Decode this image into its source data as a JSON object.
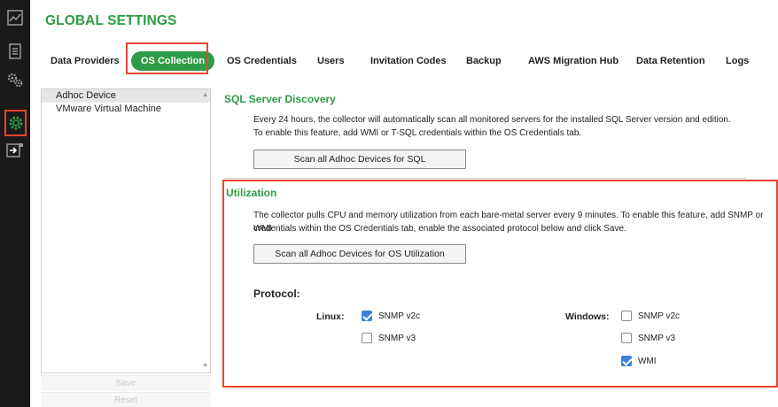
{
  "app": {
    "title": "GLOBAL SETTINGS"
  },
  "rail": {
    "icons": [
      "dashboard-icon",
      "document-icon",
      "gears-icon",
      "settings-gear-icon",
      "export-icon"
    ]
  },
  "tabs": [
    {
      "label": "Data Providers",
      "active": false
    },
    {
      "label": "OS Collection",
      "active": true
    },
    {
      "label": "OS Credentials",
      "active": false
    },
    {
      "label": "Users",
      "active": false
    },
    {
      "label": "Invitation Codes",
      "active": false
    },
    {
      "label": "Backup",
      "active": false
    },
    {
      "label": "AWS Migration Hub",
      "active": false
    },
    {
      "label": "Data Retention",
      "active": false
    },
    {
      "label": "Logs",
      "active": false
    }
  ],
  "device_list": {
    "items": [
      {
        "label": "Adhoc Device",
        "selected": true
      },
      {
        "label": "VMware Virtual Machine",
        "selected": false
      }
    ],
    "save_label": "Save",
    "reset_label": "Reset"
  },
  "sql": {
    "title": "SQL Server Discovery",
    "line1": "Every 24 hours, the collector will automatically scan all monitored servers for the installed SQL Server version and edition.",
    "line2": "To enable this feature, add WMI or T-SQL credentials within the OS Credentials tab.",
    "button": "Scan all Adhoc Devices for SQL"
  },
  "utilization": {
    "title": "Utilization",
    "line1": "The collector pulls CPU and memory utilization from each bare-metal server every 9 minutes. To enable this feature, add SNMP or WMI",
    "line2": "credentials within the OS Credentials tab, enable the associated protocol below and click Save.",
    "button": "Scan all Adhoc Devices for OS Utilization"
  },
  "protocol": {
    "title": "Protocol:",
    "linux": {
      "label": "Linux:",
      "options": [
        {
          "label": "SNMP v2c",
          "checked": true
        },
        {
          "label": "SNMP v3",
          "checked": false
        }
      ]
    },
    "windows": {
      "label": "Windows:",
      "options": [
        {
          "label": "SNMP v2c",
          "checked": false
        },
        {
          "label": "SNMP v3",
          "checked": false
        },
        {
          "label": "WMI",
          "checked": true
        }
      ]
    }
  },
  "colors": {
    "accent": "#2e9c46",
    "highlight": "#e8442a",
    "checkbox": "#3b7fd8",
    "rail": "#1a1a1a"
  }
}
